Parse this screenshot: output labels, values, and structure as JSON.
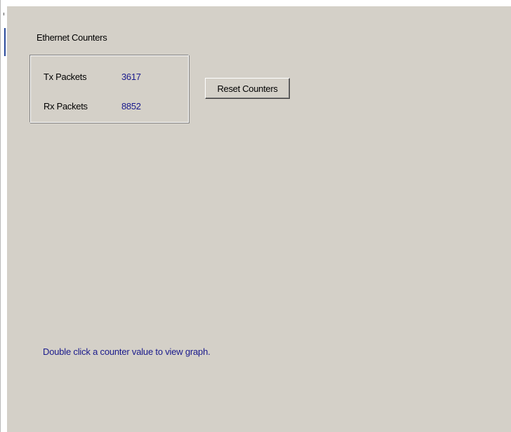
{
  "ethernet_counters": {
    "title": "Ethernet Counters",
    "tx": {
      "label": "Tx Packets",
      "value": "3617"
    },
    "rx": {
      "label": "Rx Packets",
      "value": "8852"
    }
  },
  "actions": {
    "reset_label": "Reset Counters"
  },
  "hint": "Double click a counter value to view graph.",
  "colors": {
    "panel_background": "#d4d0c8",
    "value_text": "#1a1a8c",
    "hint_text": "#1a1a8c"
  }
}
